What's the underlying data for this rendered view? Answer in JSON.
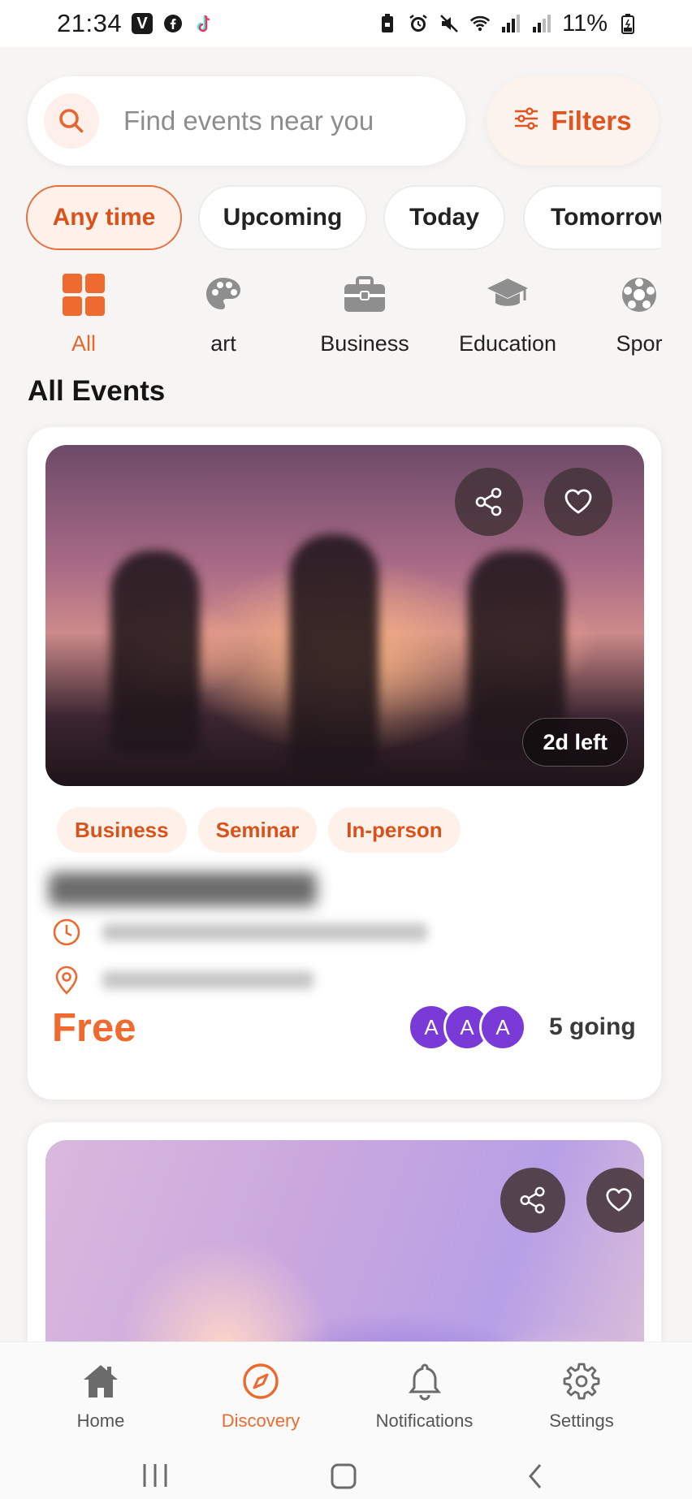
{
  "status_bar": {
    "time": "21:34",
    "battery": "11%",
    "left_icons": [
      "v-app-icon",
      "facebook-icon",
      "tiktok-icon"
    ],
    "right_icons": [
      "battery-saver-icon",
      "alarm-icon",
      "mute-icon",
      "wifi-icon",
      "signal-icon",
      "signal-icon"
    ]
  },
  "search": {
    "placeholder": "Find events near you",
    "filters_label": "Filters"
  },
  "time_filters": [
    {
      "label": "Any time",
      "active": true
    },
    {
      "label": "Upcoming",
      "active": false
    },
    {
      "label": "Today",
      "active": false
    },
    {
      "label": "Tomorrow",
      "active": false
    }
  ],
  "categories": [
    {
      "label": "All",
      "icon": "grid-icon",
      "active": true
    },
    {
      "label": "art",
      "icon": "palette-icon",
      "active": false
    },
    {
      "label": "Business",
      "icon": "briefcase-icon",
      "active": false
    },
    {
      "label": "Education",
      "icon": "graduation-cap-icon",
      "active": false
    },
    {
      "label": "Spor",
      "icon": "sports-icon",
      "active": false
    }
  ],
  "section_title": "All Events",
  "events": [
    {
      "time_left": "2d left",
      "tags": [
        "Business",
        "Seminar",
        "In-person"
      ],
      "price": "Free",
      "attendee_initials": [
        "A",
        "A",
        "A"
      ],
      "going": "5 going"
    }
  ],
  "bottom_nav": [
    {
      "label": "Home",
      "icon": "home-icon",
      "active": false
    },
    {
      "label": "Discovery",
      "icon": "compass-icon",
      "active": true
    },
    {
      "label": "Notifications",
      "icon": "bell-icon",
      "active": false
    },
    {
      "label": "Settings",
      "icon": "gear-icon",
      "active": false
    }
  ],
  "colors": {
    "accent": "#EC6A2F",
    "accent_dark": "#D9521C",
    "chip_bg": "#FDF1EA",
    "avatar": "#7A3AD8",
    "page_bg": "#F6F5F4"
  }
}
